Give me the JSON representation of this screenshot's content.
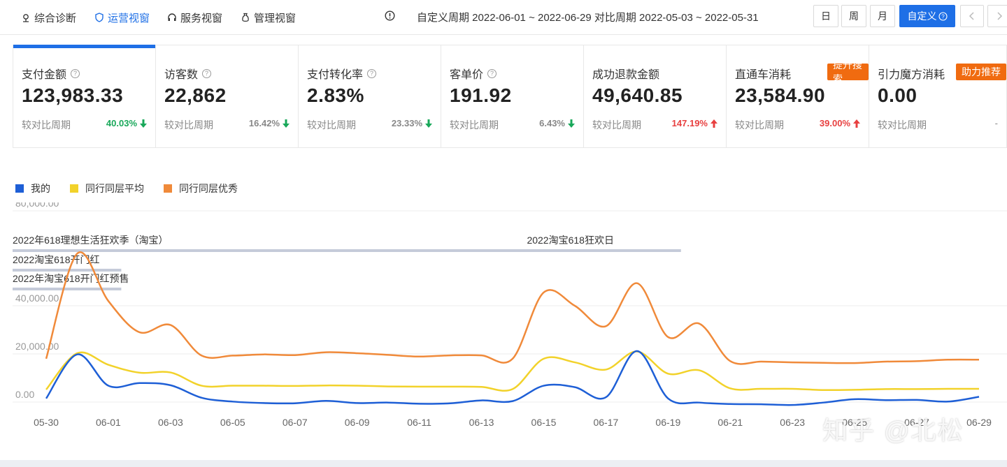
{
  "nav": {
    "tabs": [
      {
        "label": "综合诊断",
        "icon": "diagnosis-icon",
        "active": false
      },
      {
        "label": "运营视窗",
        "icon": "shield-icon",
        "active": true
      },
      {
        "label": "服务视窗",
        "icon": "headset-icon",
        "active": false
      },
      {
        "label": "管理视窗",
        "icon": "money-bag-icon",
        "active": false
      }
    ],
    "range_text": "自定义周期 2022-06-01 ~ 2022-06-29 对比周期 2022-05-03 ~ 2022-05-31",
    "period_buttons": {
      "day": "日",
      "week": "周",
      "month": "月",
      "custom": "自定义"
    }
  },
  "metrics": [
    {
      "label": "支付金额",
      "value": "123,983.33",
      "compare_label": "较对比周期",
      "pct": "40.03%",
      "trend": "down",
      "help": true
    },
    {
      "label": "访客数",
      "value": "22,862",
      "compare_label": "较对比周期",
      "pct": "16.42%",
      "trend": "down",
      "help": true
    },
    {
      "label": "支付转化率",
      "value": "2.83%",
      "compare_label": "较对比周期",
      "pct": "23.33%",
      "trend": "down",
      "help": true
    },
    {
      "label": "客单价",
      "value": "191.92",
      "compare_label": "较对比周期",
      "pct": "6.43%",
      "trend": "down",
      "help": true
    },
    {
      "label": "成功退款金额",
      "value": "49,640.85",
      "compare_label": "较对比周期",
      "pct": "147.19%",
      "trend": "up",
      "help": false
    },
    {
      "label": "直通车消耗",
      "value": "23,584.90",
      "compare_label": "较对比周期",
      "pct": "39.00%",
      "trend": "up",
      "help": false,
      "tag": "提升搜索"
    },
    {
      "label": "引力魔方消耗",
      "value": "0.00",
      "compare_label": "较对比周期",
      "pct": "-",
      "trend": "flat",
      "help": false,
      "tag": "助力推荐"
    }
  ],
  "colors": {
    "accent": "#1e6fe6",
    "mine": "#1e5fd6",
    "avg": "#f2d22a",
    "best": "#f08a3a",
    "down": "#19a85a",
    "up": "#e84040",
    "tag": "#f06b10"
  },
  "chart_data": {
    "type": "line",
    "legend": [
      "我的",
      "同行同层平均",
      "同行同层优秀"
    ],
    "y_ticks": [
      "80,000.00",
      "40,000.00",
      "20,000.00",
      "0.00"
    ],
    "ylim": [
      0,
      80000
    ],
    "x_ticks": [
      "05-30",
      "06-01",
      "06-03",
      "06-05",
      "06-07",
      "06-09",
      "06-11",
      "06-13",
      "06-15",
      "06-17",
      "06-19",
      "06-21",
      "06-23",
      "06-25",
      "06-27",
      "06-29"
    ],
    "x": [
      "05-30",
      "05-31",
      "06-01",
      "06-02",
      "06-03",
      "06-04",
      "06-05",
      "06-06",
      "06-07",
      "06-08",
      "06-09",
      "06-10",
      "06-11",
      "06-12",
      "06-13",
      "06-14",
      "06-15",
      "06-16",
      "06-17",
      "06-18",
      "06-19",
      "06-20",
      "06-21",
      "06-22",
      "06-23",
      "06-24",
      "06-25",
      "06-26",
      "06-27",
      "06-28",
      "06-29"
    ],
    "series": [
      {
        "name": "我的",
        "values": [
          1500,
          19800,
          6800,
          7900,
          7000,
          1800,
          200,
          -400,
          -500,
          500,
          -400,
          -200,
          -700,
          -500,
          700,
          400,
          6800,
          6200,
          2000,
          21200,
          1500,
          -200,
          -800,
          -900,
          -1200,
          -200,
          1200,
          800,
          900,
          200,
          2200
        ]
      },
      {
        "name": "同行同层平均",
        "values": [
          5200,
          20300,
          15500,
          12200,
          12300,
          6800,
          6800,
          6800,
          6700,
          6900,
          6800,
          6500,
          6400,
          6400,
          6300,
          5400,
          18000,
          16500,
          13500,
          21000,
          11800,
          13200,
          5700,
          5500,
          5500,
          5000,
          5100,
          5400,
          5400,
          5500,
          5500
        ]
      },
      {
        "name": "同行同层优秀",
        "values": [
          18000,
          62000,
          42000,
          29000,
          32000,
          19300,
          19300,
          19800,
          19500,
          20700,
          20300,
          19600,
          18900,
          19400,
          19400,
          18000,
          45600,
          40000,
          31500,
          49500,
          27000,
          32600,
          17000,
          16800,
          16500,
          16300,
          16200,
          16800,
          17000,
          17600,
          17600
        ]
      }
    ],
    "annotations": [
      {
        "text": "2022年618理想生活狂欢季（淘宝）",
        "start": "05-30",
        "end": "06-20",
        "row": 0
      },
      {
        "text": "2022淘宝618狂欢日",
        "start": "06-15",
        "end": "06-20",
        "row": 0,
        "label_only": true
      },
      {
        "text": "2022淘宝618开门红",
        "start": "05-30",
        "end": "06-02",
        "row": 1
      },
      {
        "text": "2022年淘宝618开门红预售",
        "start": "05-30",
        "end": "06-02",
        "row": 2
      }
    ]
  },
  "watermark": "知乎 @北松"
}
